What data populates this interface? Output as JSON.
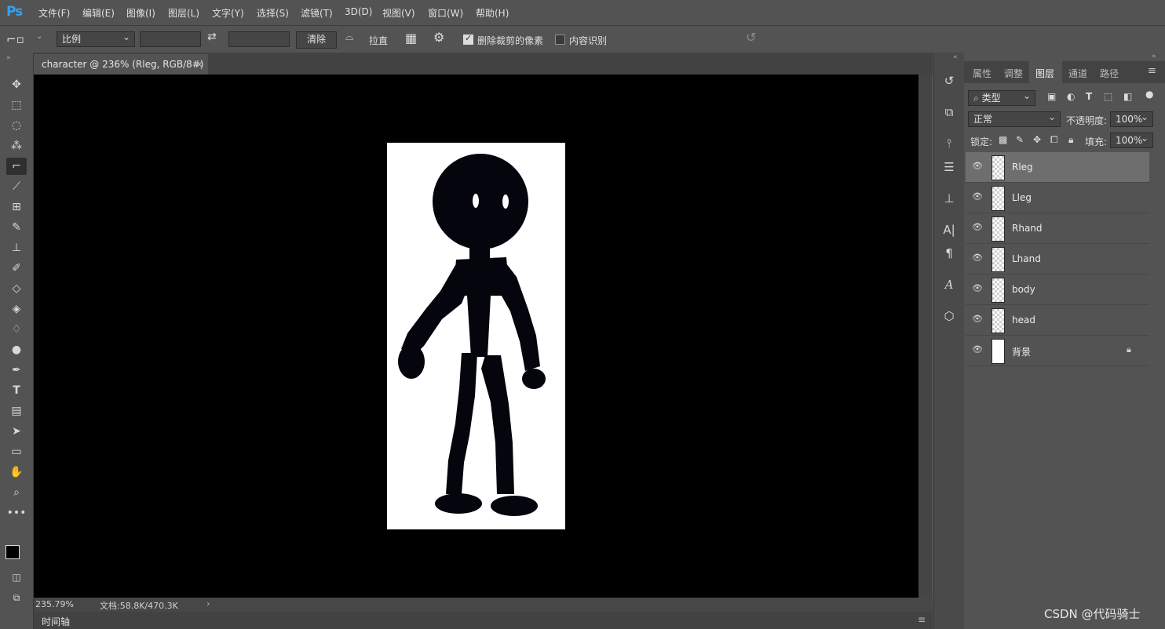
{
  "app": {
    "logo": "Ps"
  },
  "menu": [
    "文件(F)",
    "编辑(E)",
    "图像(I)",
    "图层(L)",
    "文字(Y)",
    "选择(S)",
    "滤镜(T)",
    "3D(D)",
    "视图(V)",
    "窗口(W)",
    "帮助(H)"
  ],
  "options": {
    "ratio_select": "比例",
    "clear_button": "清除",
    "straighten_label": "拉直",
    "delete_cropped_label": "删除裁剪的像素",
    "delete_cropped_checked": true,
    "content_aware_label": "内容识别",
    "content_aware_checked": false
  },
  "document": {
    "tab_title": "character @ 236% (Rleg, RGB/8#) *",
    "zoom": "235.79%",
    "doc_size": "文档:58.8K/470.3K",
    "canvas_color": "#000000",
    "artboard_color": "#ffffff"
  },
  "timeline": {
    "label": "时间轴"
  },
  "panels": {
    "tabs": [
      "属性",
      "调整",
      "图层",
      "通道",
      "路径"
    ],
    "active_tab": "图层",
    "filter_kind": "类型",
    "blend_mode": "正常",
    "opacity_label": "不透明度:",
    "opacity_value": "100%",
    "lock_label": "锁定:",
    "fill_label": "填充:",
    "fill_value": "100%"
  },
  "layers": [
    {
      "name": "Rleg",
      "selected": true,
      "locked": false
    },
    {
      "name": "Lleg",
      "selected": false,
      "locked": false
    },
    {
      "name": "Rhand",
      "selected": false,
      "locked": false
    },
    {
      "name": "Lhand",
      "selected": false,
      "locked": false
    },
    {
      "name": "body",
      "selected": false,
      "locked": false
    },
    {
      "name": "head",
      "selected": false,
      "locked": false
    },
    {
      "name": "背景",
      "selected": false,
      "locked": true
    }
  ],
  "watermark": "CSDN @代码骑士"
}
